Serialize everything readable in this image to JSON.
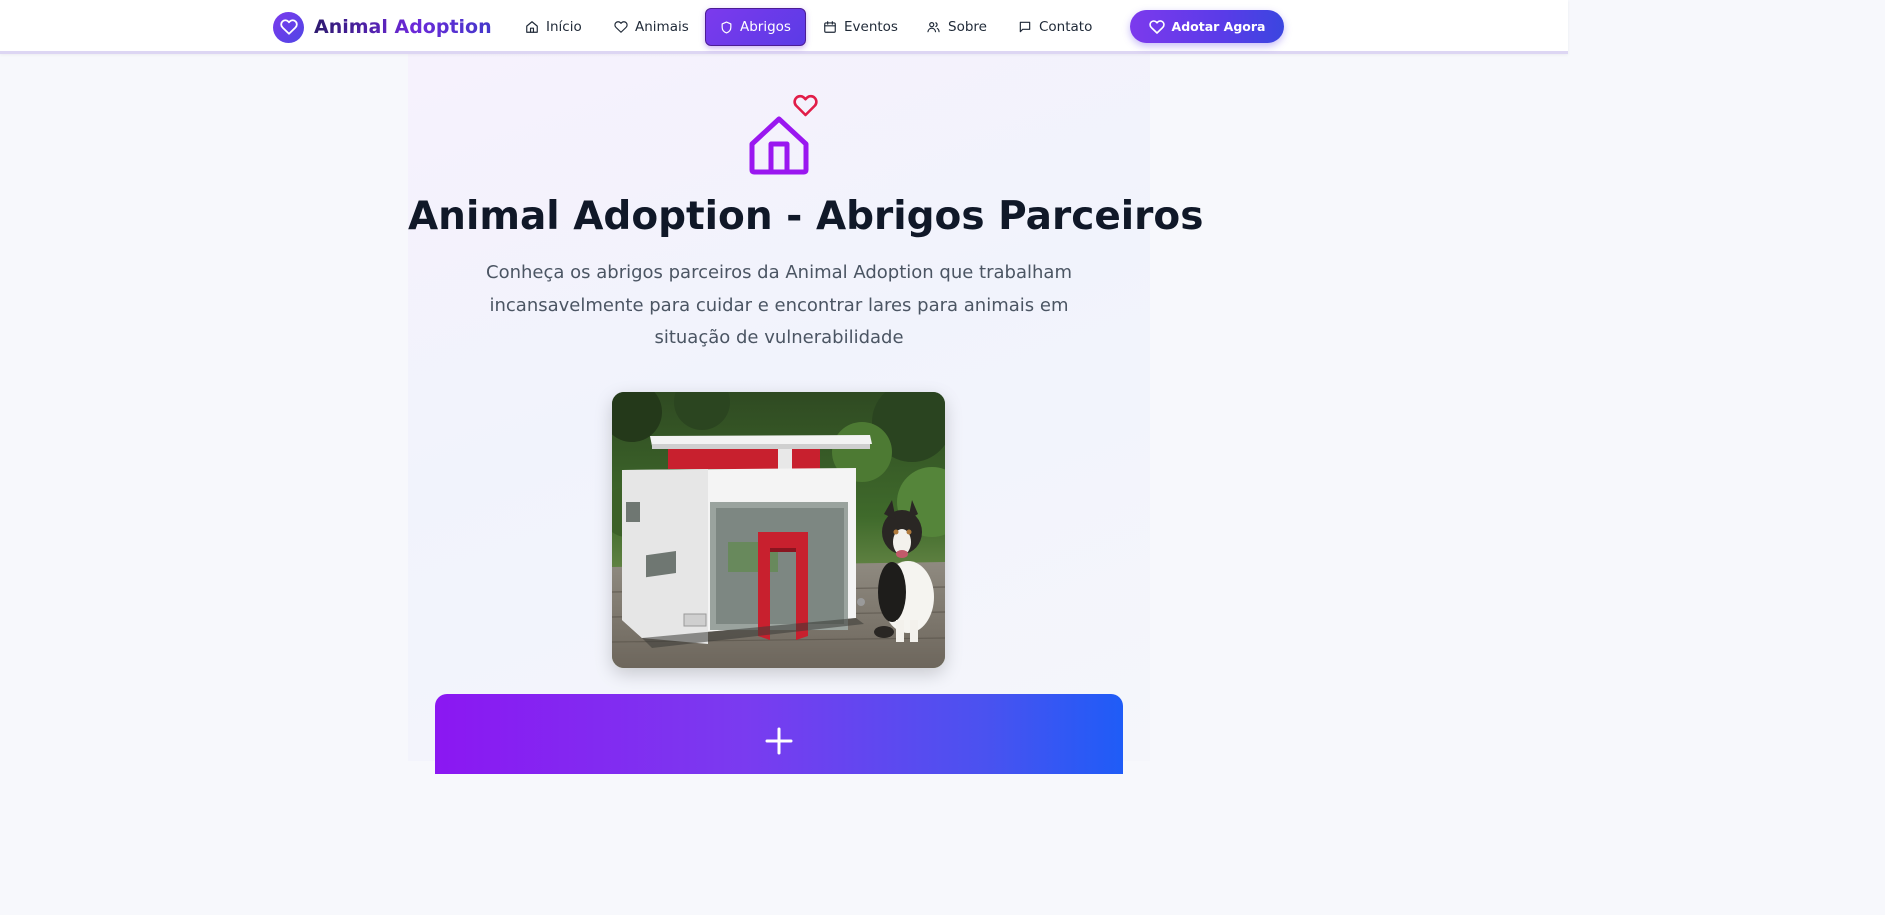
{
  "header": {
    "brand": "Animal Adoption",
    "nav": [
      {
        "label": "Início",
        "icon": "home-icon"
      },
      {
        "label": "Animais",
        "icon": "heart-icon"
      },
      {
        "label": "Abrigos",
        "icon": "shield-icon",
        "active": true
      },
      {
        "label": "Eventos",
        "icon": "calendar-icon"
      },
      {
        "label": "Sobre",
        "icon": "users-icon"
      },
      {
        "label": "Contato",
        "icon": "message-icon"
      }
    ],
    "cta_label": "Adotar Agora"
  },
  "hero": {
    "icon": "house-heart-icon",
    "title": "Animal Adoption - Abrigos Parceiros",
    "subtitle": "Conheça os abrigos parceiros da Animal Adoption que trabalham incansavelmente para cuidar e encontrar lares para animais em situação de vulnerabilidade",
    "image": "modern-doghouse-with-dog"
  },
  "banner": {
    "icon": "plus-icon"
  },
  "colors": {
    "accent": "#7c3aed",
    "accent_blue": "#3b46e0",
    "heart_red": "#e11d48",
    "title": "#101828",
    "text": "#4b5563"
  }
}
